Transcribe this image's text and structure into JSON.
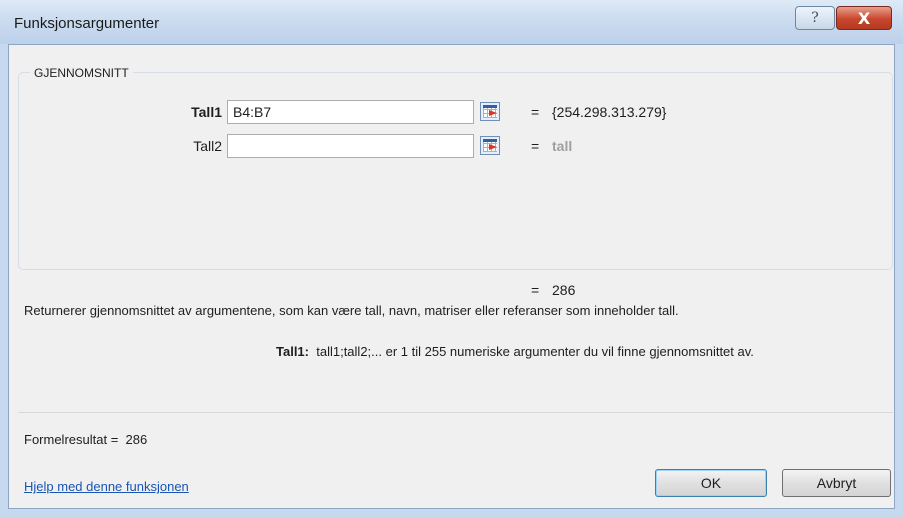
{
  "window": {
    "title": "Funksjonsargumenter",
    "help_glyph": "?",
    "close_glyph": "X"
  },
  "group": {
    "legend": "GJENNOMSNITT"
  },
  "arguments": [
    {
      "label": "Tall1",
      "value": "B4:B7",
      "equals": "=",
      "result": "{254.298.313.279}"
    },
    {
      "label": "Tall2",
      "value": "",
      "equals": "=",
      "result": "tall"
    }
  ],
  "result": {
    "equals": "=",
    "value": "286"
  },
  "description": "Returnerer gjennomsnittet av argumentene, som kan være tall, navn, matriser eller referanser som inneholder tall.",
  "argument_help": {
    "name": "Tall1:",
    "text": "tall1;tall2;... er 1 til 255 numeriske argumenter du vil finne gjennomsnittet av."
  },
  "formula_result": {
    "label": "Formelresultat =",
    "value": "286"
  },
  "help_link": "Hjelp med denne funksjonen",
  "buttons": {
    "ok": "OK",
    "cancel": "Avbryt"
  },
  "icons": {
    "ref_button": "collapse-dialog-icon"
  }
}
